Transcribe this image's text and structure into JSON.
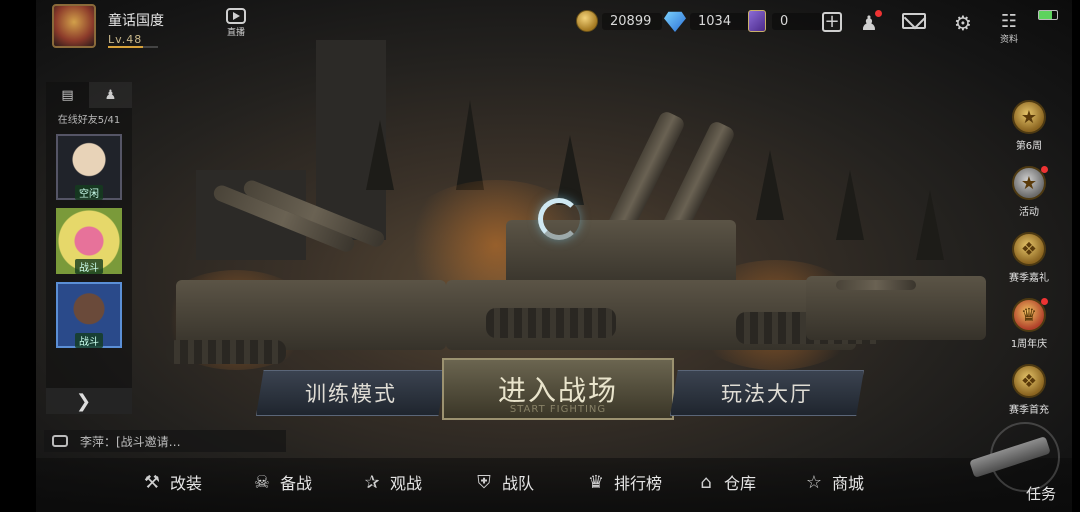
{
  "player": {
    "name": "童话国度",
    "level": "Lv.48",
    "level_progress": 0.7
  },
  "topbar": {
    "live_label": "直播",
    "gold": "20899",
    "diamonds": "1034",
    "cards": "0",
    "info_label": "资料"
  },
  "friends": {
    "online_count": "在线好友5/41",
    "items": [
      {
        "status": "空闲"
      },
      {
        "status": "战斗"
      },
      {
        "status": "战斗"
      }
    ]
  },
  "chat": {
    "message": "李萍：[战斗邀请…"
  },
  "modes": {
    "training": "训练模式",
    "enter": "进入战场",
    "enter_sub": "START FIGHTING",
    "lobby": "玩法大厅"
  },
  "events": [
    {
      "label": "第6周",
      "icon": "star-medal-icon"
    },
    {
      "label": "活动",
      "icon": "star-badge-icon"
    },
    {
      "label": "赛季嘉礼",
      "icon": "season-gift-icon"
    },
    {
      "label": "1周年庆",
      "icon": "trophy-icon"
    },
    {
      "label": "赛季首充",
      "icon": "season-recharge-icon"
    }
  ],
  "bottom_nav": [
    {
      "label": "改装",
      "icon": "wrench-icon"
    },
    {
      "label": "备战",
      "icon": "gasmask-icon"
    },
    {
      "label": "观战",
      "icon": "star-eye-icon"
    },
    {
      "label": "战队",
      "icon": "shield-icon"
    },
    {
      "label": "排行榜",
      "icon": "trophy-icon"
    },
    {
      "label": "仓库",
      "icon": "warehouse-icon"
    },
    {
      "label": "商城",
      "icon": "shop-icon"
    }
  ],
  "task_label": "任务",
  "colors": {
    "accent_gold": "#d7a23a",
    "battery": "#5ed35e",
    "notify": "#e33333"
  }
}
